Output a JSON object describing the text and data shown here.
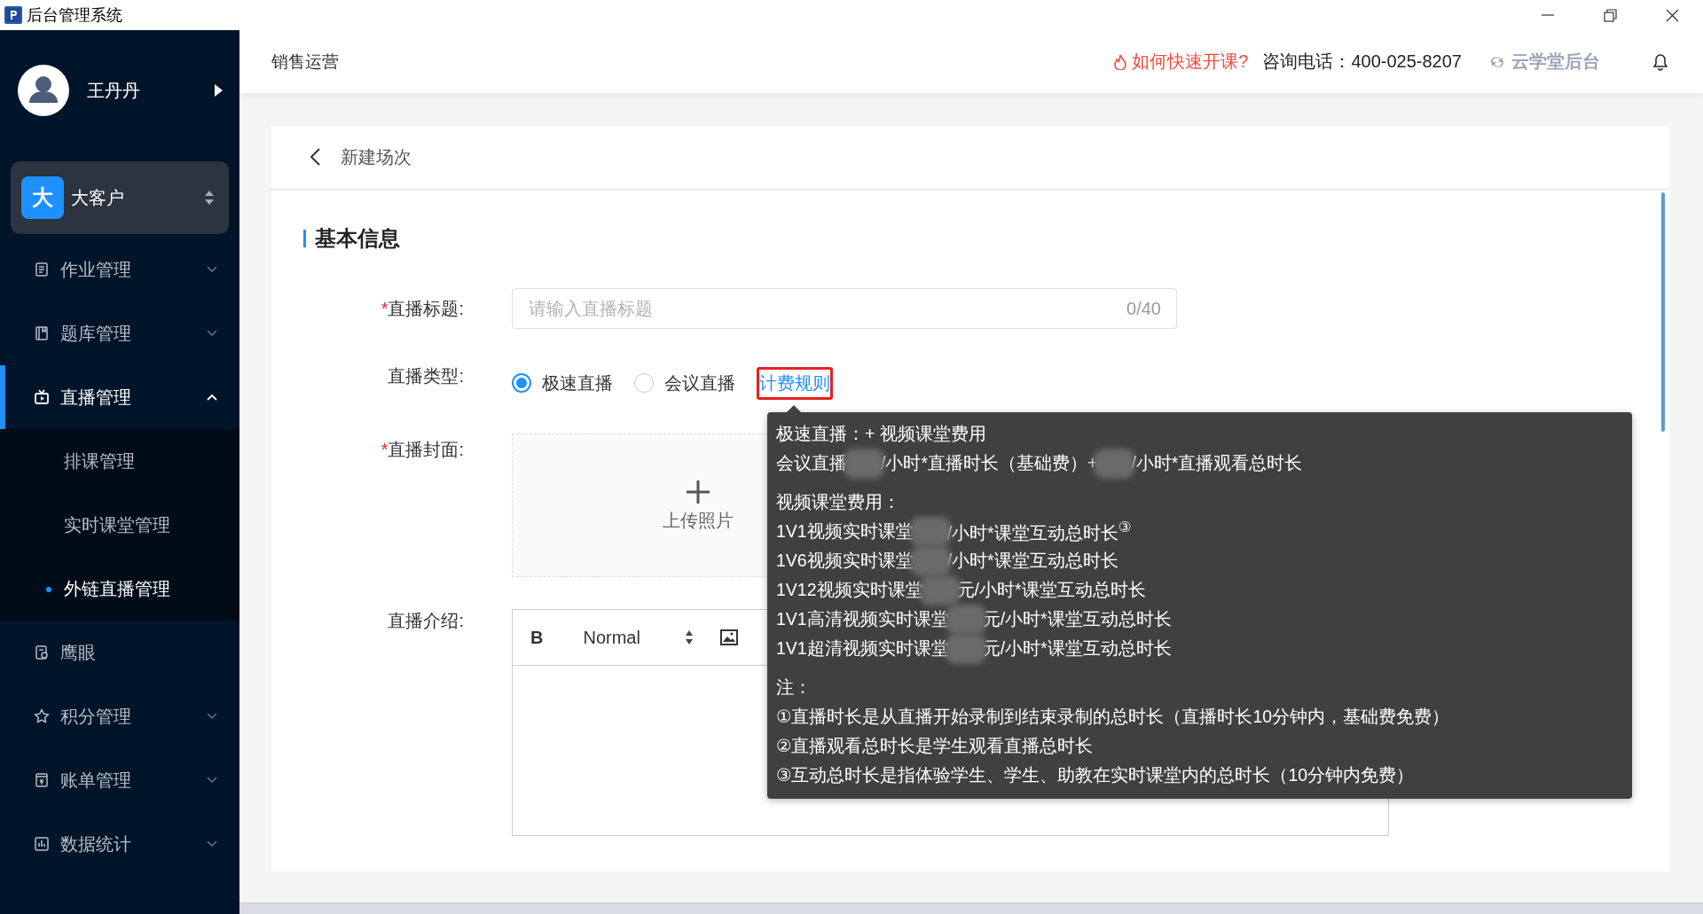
{
  "window": {
    "title": "后台管理系统"
  },
  "sidebar": {
    "user": {
      "name": "王丹丹"
    },
    "account": {
      "badge": "大",
      "label": "大客户"
    },
    "items": [
      {
        "label": "作业管理",
        "kind": "group",
        "expanded": false,
        "selected": false
      },
      {
        "label": "题库管理",
        "kind": "group",
        "expanded": false,
        "selected": false
      },
      {
        "label": "直播管理",
        "kind": "group",
        "expanded": true,
        "selected": true,
        "children": [
          {
            "label": "排课管理",
            "selected": false
          },
          {
            "label": "实时课堂管理",
            "selected": false
          },
          {
            "label": "外链直播管理",
            "selected": true
          }
        ]
      },
      {
        "label": "鹰眼",
        "kind": "link",
        "selected": false
      },
      {
        "label": "积分管理",
        "kind": "group",
        "expanded": false,
        "selected": false
      },
      {
        "label": "账单管理",
        "kind": "group",
        "expanded": false,
        "selected": false
      },
      {
        "label": "数据统计",
        "kind": "group",
        "expanded": false,
        "selected": false
      }
    ]
  },
  "header": {
    "section": "销售运营",
    "help_link": "如何快速开课?",
    "phone": "咨询电话：400-025-8207",
    "brand": "云学堂后台"
  },
  "page": {
    "title": "新建场次",
    "section_title": "基本信息",
    "fields": [
      {
        "kind": "text",
        "required_mark": "*",
        "label": "直播标题:",
        "placeholder": "请输入直播标题",
        "counter": "0/40"
      },
      {
        "kind": "radio",
        "label": "直播类型:",
        "options": [
          {
            "label": "极速直播",
            "selected": true
          },
          {
            "label": "会议直播",
            "selected": false
          }
        ],
        "link": "计费规则"
      },
      {
        "kind": "upload",
        "required_mark": "*",
        "label": "直播封面:",
        "upload_label": "上传照片"
      },
      {
        "kind": "editor",
        "label": "直播介绍:",
        "bold": "B",
        "format": "Normal"
      }
    ]
  },
  "tooltip": {
    "sections": [
      [
        {
          "segments": [
            "极速直播：+ 视频课堂费用"
          ]
        },
        {
          "segments": [
            "会议直播",
            "/小时*直播时长（基础费）+",
            "/小时*直播观看总时长"
          ]
        }
      ],
      [
        {
          "segments": [
            "视频课堂费用："
          ]
        },
        {
          "segments": [
            "1V1视频实时课堂",
            "/小时*课堂互动总时长$^{③}$"
          ]
        },
        {
          "segments": [
            "1V6视频实时课堂",
            "/小时*课堂互动总时长"
          ]
        },
        {
          "segments": [
            "1V12视频实时课堂",
            "元/小时*课堂互动总时长"
          ]
        },
        {
          "segments": [
            "1V1高清视频实时课堂",
            "元/小时*课堂互动总时长"
          ]
        },
        {
          "segments": [
            "1V1超清视频实时课堂",
            "元/小时*课堂互动总时长"
          ]
        }
      ],
      [
        {
          "segments": [
            "注："
          ]
        },
        {
          "segments": [
            "①直播时长是从直播开始录制到结束录制的总时长（直播时长10分钟内，基础费免费）"
          ]
        },
        {
          "segments": [
            "②直播观看总时长是学生观看直播总时长"
          ]
        },
        {
          "segments": [
            "③互动总时长是指体验学生、学生、助教在实时课堂内的总时长（10分钟内免费）"
          ]
        }
      ]
    ]
  }
}
